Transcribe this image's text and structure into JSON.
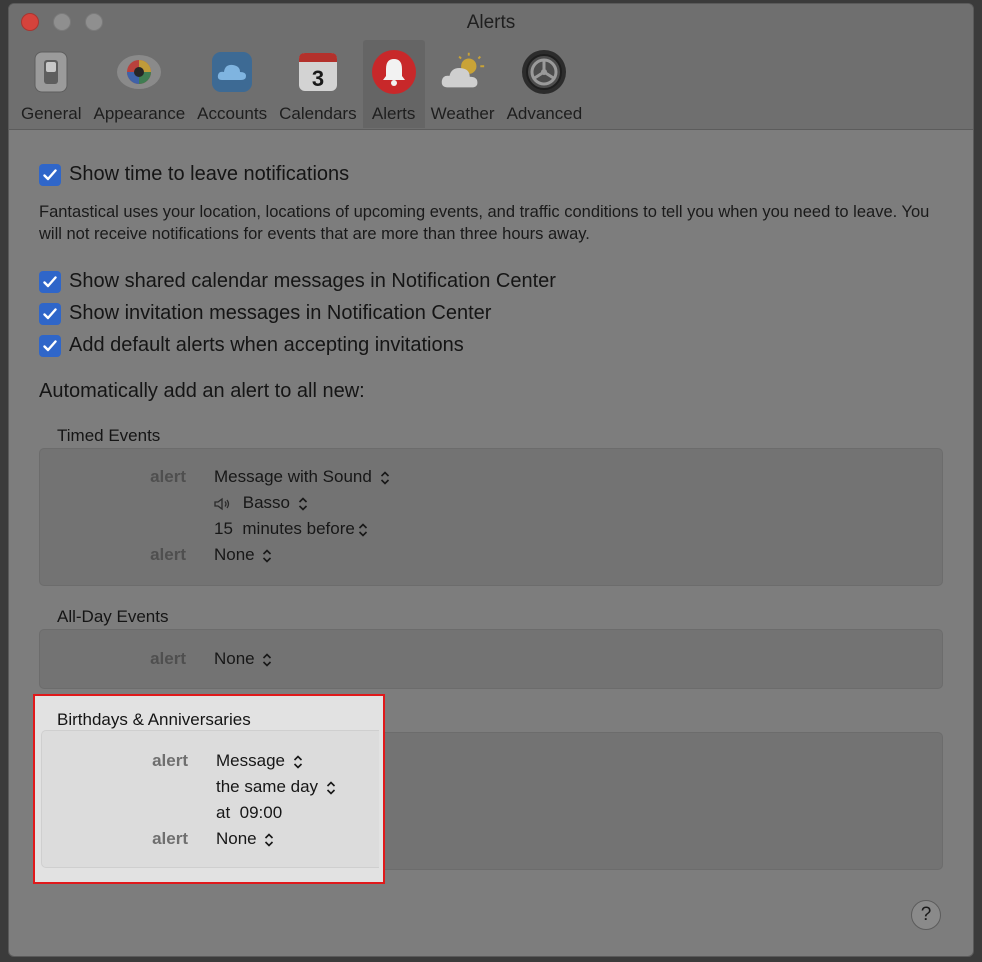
{
  "window": {
    "title": "Alerts"
  },
  "toolbar": {
    "items": [
      {
        "label": "General",
        "icon": "general-switch-icon"
      },
      {
        "label": "Appearance",
        "icon": "appearance-color-icon"
      },
      {
        "label": "Accounts",
        "icon": "accounts-cloud-icon"
      },
      {
        "label": "Calendars",
        "icon": "calendar-icon",
        "badge": "3"
      },
      {
        "label": "Alerts",
        "icon": "bell-icon",
        "active": true
      },
      {
        "label": "Weather",
        "icon": "weather-icon"
      },
      {
        "label": "Advanced",
        "icon": "advanced-gear-icon"
      }
    ]
  },
  "options": {
    "time_to_leave": {
      "label": "Show time to leave notifications",
      "checked": true
    },
    "description": "Fantastical uses your location, locations of upcoming events, and traffic conditions to tell you when you need to leave. You will not receive notifications for events that are more than three hours away.",
    "shared_calendar": {
      "label": "Show shared calendar messages in Notification Center",
      "checked": true
    },
    "invitation_messages": {
      "label": "Show invitation messages in Notification Center",
      "checked": true
    },
    "default_alerts": {
      "label": "Add default alerts when accepting invitations",
      "checked": true
    }
  },
  "auto_add_label": "Automatically add an alert to all new:",
  "timed_events": {
    "title": "Timed Events",
    "alert_label": "alert",
    "alert1_type": "Message with Sound",
    "sound": "Basso",
    "offset_value": "15",
    "offset_unit": "minutes before",
    "alert2_label": "alert",
    "alert2_type": "None"
  },
  "all_day_events": {
    "title": "All-Day Events",
    "alert_label": "alert",
    "alert_type": "None"
  },
  "birthdays": {
    "title": "Birthdays & Anniversaries",
    "alert_label": "alert",
    "alert1_type": "Message",
    "day": "the same day",
    "at_label": "at",
    "time": "09:00",
    "alert2_label": "alert",
    "alert2_type": "None"
  },
  "help_label": "?",
  "colors": {
    "accent": "#2f66c9",
    "highlight_border": "#e0191b",
    "close": "#d5433c"
  }
}
